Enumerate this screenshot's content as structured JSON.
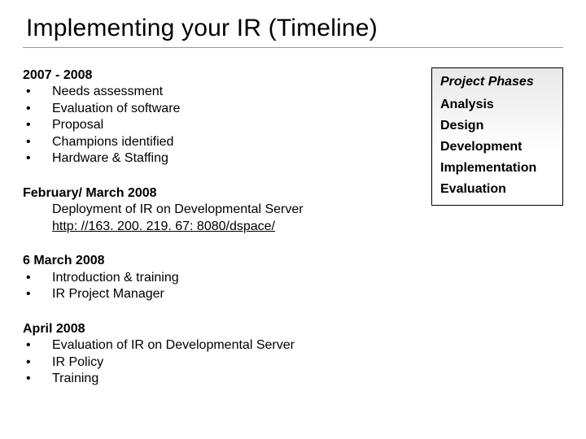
{
  "title": "Implementing your IR (Timeline)",
  "sections": [
    {
      "heading": "2007 - 2008",
      "items": [
        "Needs assessment",
        "Evaluation of software",
        "Proposal",
        "Champions identified",
        "Hardware & Staffing"
      ]
    },
    {
      "heading": "February/ March 2008",
      "indent_lines": [
        "Deployment of IR on Developmental Server"
      ],
      "link": "http: //163. 200. 219. 67: 8080/dspace/"
    },
    {
      "heading": "6 March 2008",
      "items": [
        "Introduction & training",
        "IR Project Manager"
      ]
    },
    {
      "heading": "April 2008",
      "items": [
        "Evaluation of IR on Developmental Server",
        "IR Policy",
        "Training"
      ]
    }
  ],
  "phases": {
    "title": "Project Phases",
    "items": [
      "Analysis",
      "Design",
      "Development",
      "Implementation",
      "Evaluation"
    ]
  }
}
